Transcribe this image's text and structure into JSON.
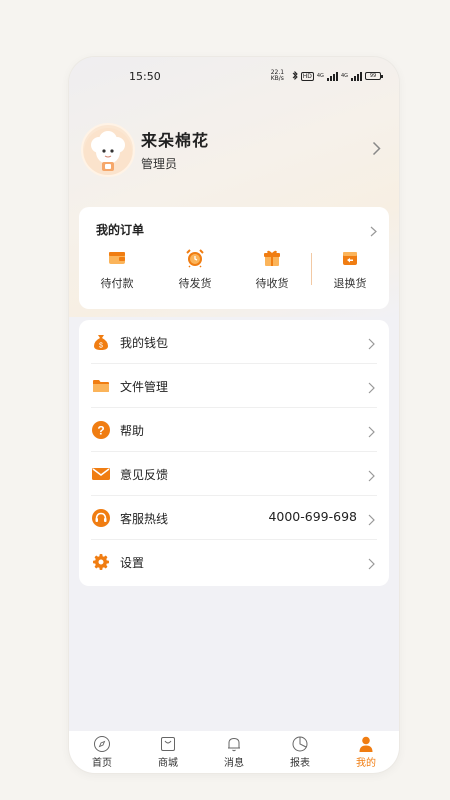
{
  "status_bar": {
    "time": "15:50",
    "net_speed": "22.1 KB/s",
    "hd_badge": "HD",
    "net_type_1": "4G",
    "net_type_2": "4G",
    "battery": "99"
  },
  "profile": {
    "name": "来朵棉花",
    "role": "管理员"
  },
  "orders": {
    "title": "我的订单",
    "items": [
      {
        "label": "待付款",
        "icon": "wallet-icon"
      },
      {
        "label": "待发货",
        "icon": "alarm-clock-icon"
      },
      {
        "label": "待收货",
        "icon": "gift-box-icon"
      },
      {
        "label": "退换货",
        "icon": "return-box-icon"
      }
    ]
  },
  "menu": {
    "items": [
      {
        "label": "我的钱包",
        "icon": "money-bag-icon",
        "value": ""
      },
      {
        "label": "文件管理",
        "icon": "folder-icon",
        "value": ""
      },
      {
        "label": "帮助",
        "icon": "help-icon",
        "value": ""
      },
      {
        "label": "意见反馈",
        "icon": "envelope-icon",
        "value": ""
      },
      {
        "label": "客服热线",
        "icon": "headset-icon",
        "value": "4000-699-698"
      },
      {
        "label": "设置",
        "icon": "gear-icon",
        "value": ""
      }
    ]
  },
  "tabbar": {
    "items": [
      {
        "label": "首页",
        "icon": "compass-icon"
      },
      {
        "label": "商城",
        "icon": "shopping-bag-icon"
      },
      {
        "label": "消息",
        "icon": "bell-icon"
      },
      {
        "label": "报表",
        "icon": "pie-chart-icon"
      },
      {
        "label": "我的",
        "icon": "person-icon"
      }
    ],
    "active_index": 4
  },
  "colors": {
    "accent": "#f07d12",
    "accent_light": "#fbb45a",
    "background": "#f1f1f5",
    "card": "#ffffff"
  }
}
